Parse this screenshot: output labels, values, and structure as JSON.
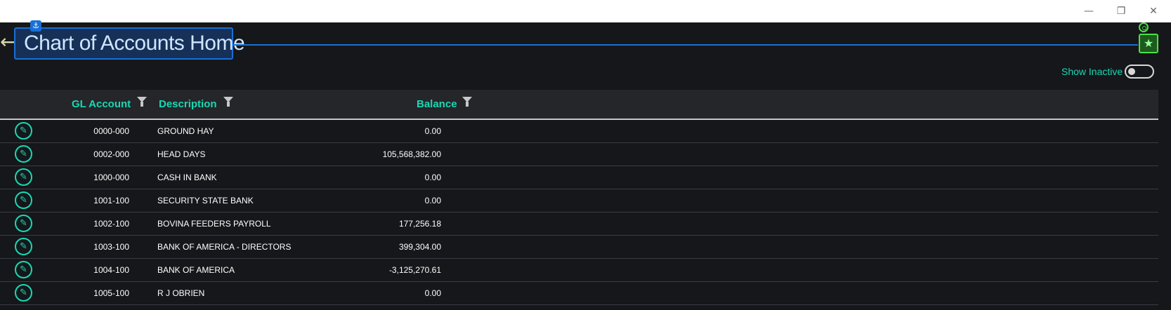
{
  "window": {
    "min_label": "—",
    "restore_label": "❐",
    "close_label": "✕"
  },
  "header": {
    "back_label": "⟵",
    "anchor_label": "⚓",
    "title": "Chart of Accounts Home"
  },
  "right_icons": {
    "star_label": "★"
  },
  "filters": {
    "show_inactive_label": "Show Inactive",
    "show_inactive": false
  },
  "grid": {
    "columns": [
      "GL Account",
      "Description",
      "Balance"
    ],
    "rows": [
      {
        "account": "0000-000",
        "description": "GROUND HAY",
        "balance": "0.00"
      },
      {
        "account": "0002-000",
        "description": "HEAD DAYS",
        "balance": "105,568,382.00"
      },
      {
        "account": "1000-000",
        "description": "CASH IN BANK",
        "balance": "0.00"
      },
      {
        "account": "1001-100",
        "description": "SECURITY STATE BANK",
        "balance": "0.00"
      },
      {
        "account": "1002-100",
        "description": "BOVINA FEEDERS PAYROLL",
        "balance": "177,256.18"
      },
      {
        "account": "1003-100",
        "description": "BANK OF AMERICA - DIRECTORS",
        "balance": "399,304.00"
      },
      {
        "account": "1004-100",
        "description": "BANK OF AMERICA",
        "balance": "-3,125,270.61"
      },
      {
        "account": "1005-100",
        "description": "R J OBRIEN",
        "balance": "0.00"
      }
    ],
    "edit_icon_label": "✎"
  }
}
